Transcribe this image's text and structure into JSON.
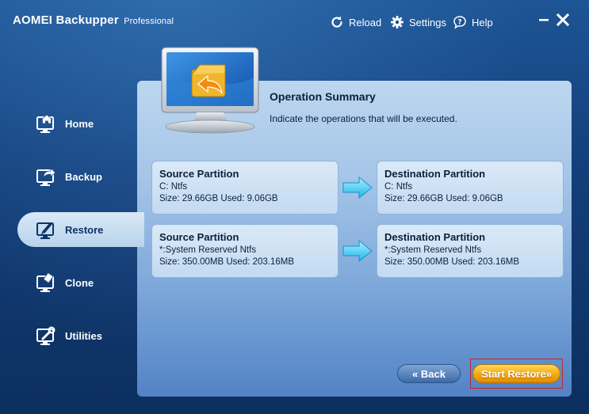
{
  "app": {
    "title": "AOMEI Backupper",
    "edition": "Professional"
  },
  "topbar": {
    "reload": "Reload",
    "settings": "Settings",
    "help": "Help"
  },
  "sidebar": {
    "items": [
      {
        "label": "Home",
        "icon": "home-icon"
      },
      {
        "label": "Backup",
        "icon": "backup-icon"
      },
      {
        "label": "Restore",
        "icon": "restore-icon",
        "active": true
      },
      {
        "label": "Clone",
        "icon": "clone-icon"
      },
      {
        "label": "Utilities",
        "icon": "utilities-icon"
      }
    ]
  },
  "summary": {
    "title": "Operation Summary",
    "description": "Indicate the operations that will be executed."
  },
  "operations": [
    {
      "source": {
        "heading": "Source Partition",
        "name": "C: Ntfs",
        "size": "Size: 29.66GB  Used: 9.06GB"
      },
      "destination": {
        "heading": "Destination Partition",
        "name": "C: Ntfs",
        "size": "Size: 29.66GB  Used: 9.06GB"
      }
    },
    {
      "source": {
        "heading": "Source Partition",
        "name": "*:System Reserved Ntfs",
        "size": "Size: 350.00MB  Used: 203.16MB"
      },
      "destination": {
        "heading": "Destination Partition",
        "name": "*:System Reserved Ntfs",
        "size": "Size: 350.00MB  Used: 203.16MB"
      }
    }
  ],
  "buttons": {
    "back": "« Back",
    "start": "Start Restore»"
  },
  "colors": {
    "accent": "#f2a90f",
    "focus": "#c0282d",
    "background": "#143f7a"
  }
}
